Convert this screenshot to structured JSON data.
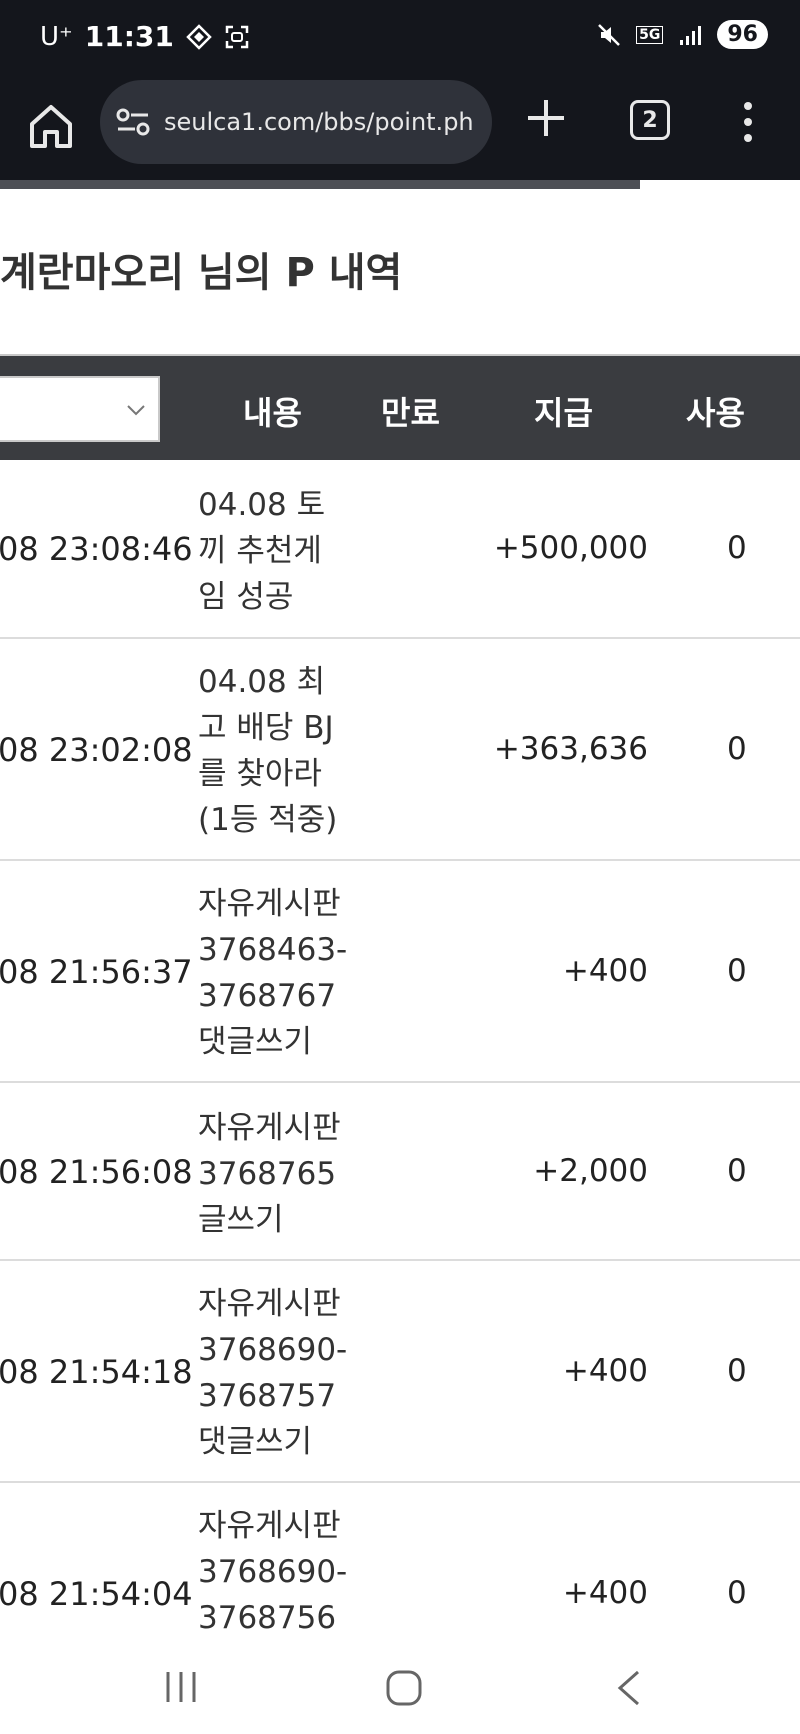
{
  "status_bar": {
    "carrier": "U⁺",
    "time": "11:31",
    "network": "5G",
    "battery": "96"
  },
  "browser": {
    "url": "seulca1.com/bbs/point.ph",
    "tab_count": "2",
    "page_load_progress": 0.8
  },
  "page": {
    "title": "계란마오리 님의 P 내역"
  },
  "table": {
    "headers": {
      "content": "내용",
      "expire": "만료",
      "give": "지급",
      "use": "사용"
    },
    "rows": [
      {
        "date": "08 23:08:46",
        "content": "04.08 토\n끼 추천게\n임 성공",
        "give": "+500,000",
        "use": "0"
      },
      {
        "date": "08 23:02:08",
        "content": "04.08 최\n고 배당 BJ\n를 찾아라\n(1등 적중)",
        "give": "+363,636",
        "use": "0"
      },
      {
        "date": "08 21:56:37",
        "content": "자유게시판\n3768463-\n3768767\n댓글쓰기",
        "give": "+400",
        "use": "0"
      },
      {
        "date": "08 21:56:08",
        "content": "자유게시판\n3768765\n글쓰기",
        "give": "+2,000",
        "use": "0"
      },
      {
        "date": "08 21:54:18",
        "content": "자유게시판\n3768690-\n3768757\n댓글쓰기",
        "give": "+400",
        "use": "0"
      },
      {
        "date": "08 21:54:04",
        "content": "자유게시판\n3768690-\n3768756",
        "give": "+400",
        "use": "0"
      }
    ]
  },
  "icons": {
    "home": "home-icon",
    "site_settings": "tune-icon",
    "new_tab": "plus-icon",
    "menu": "more-vert-icon",
    "recent_apps": "recent-apps-icon",
    "nav_home": "nav-home-icon",
    "back": "back-icon"
  }
}
